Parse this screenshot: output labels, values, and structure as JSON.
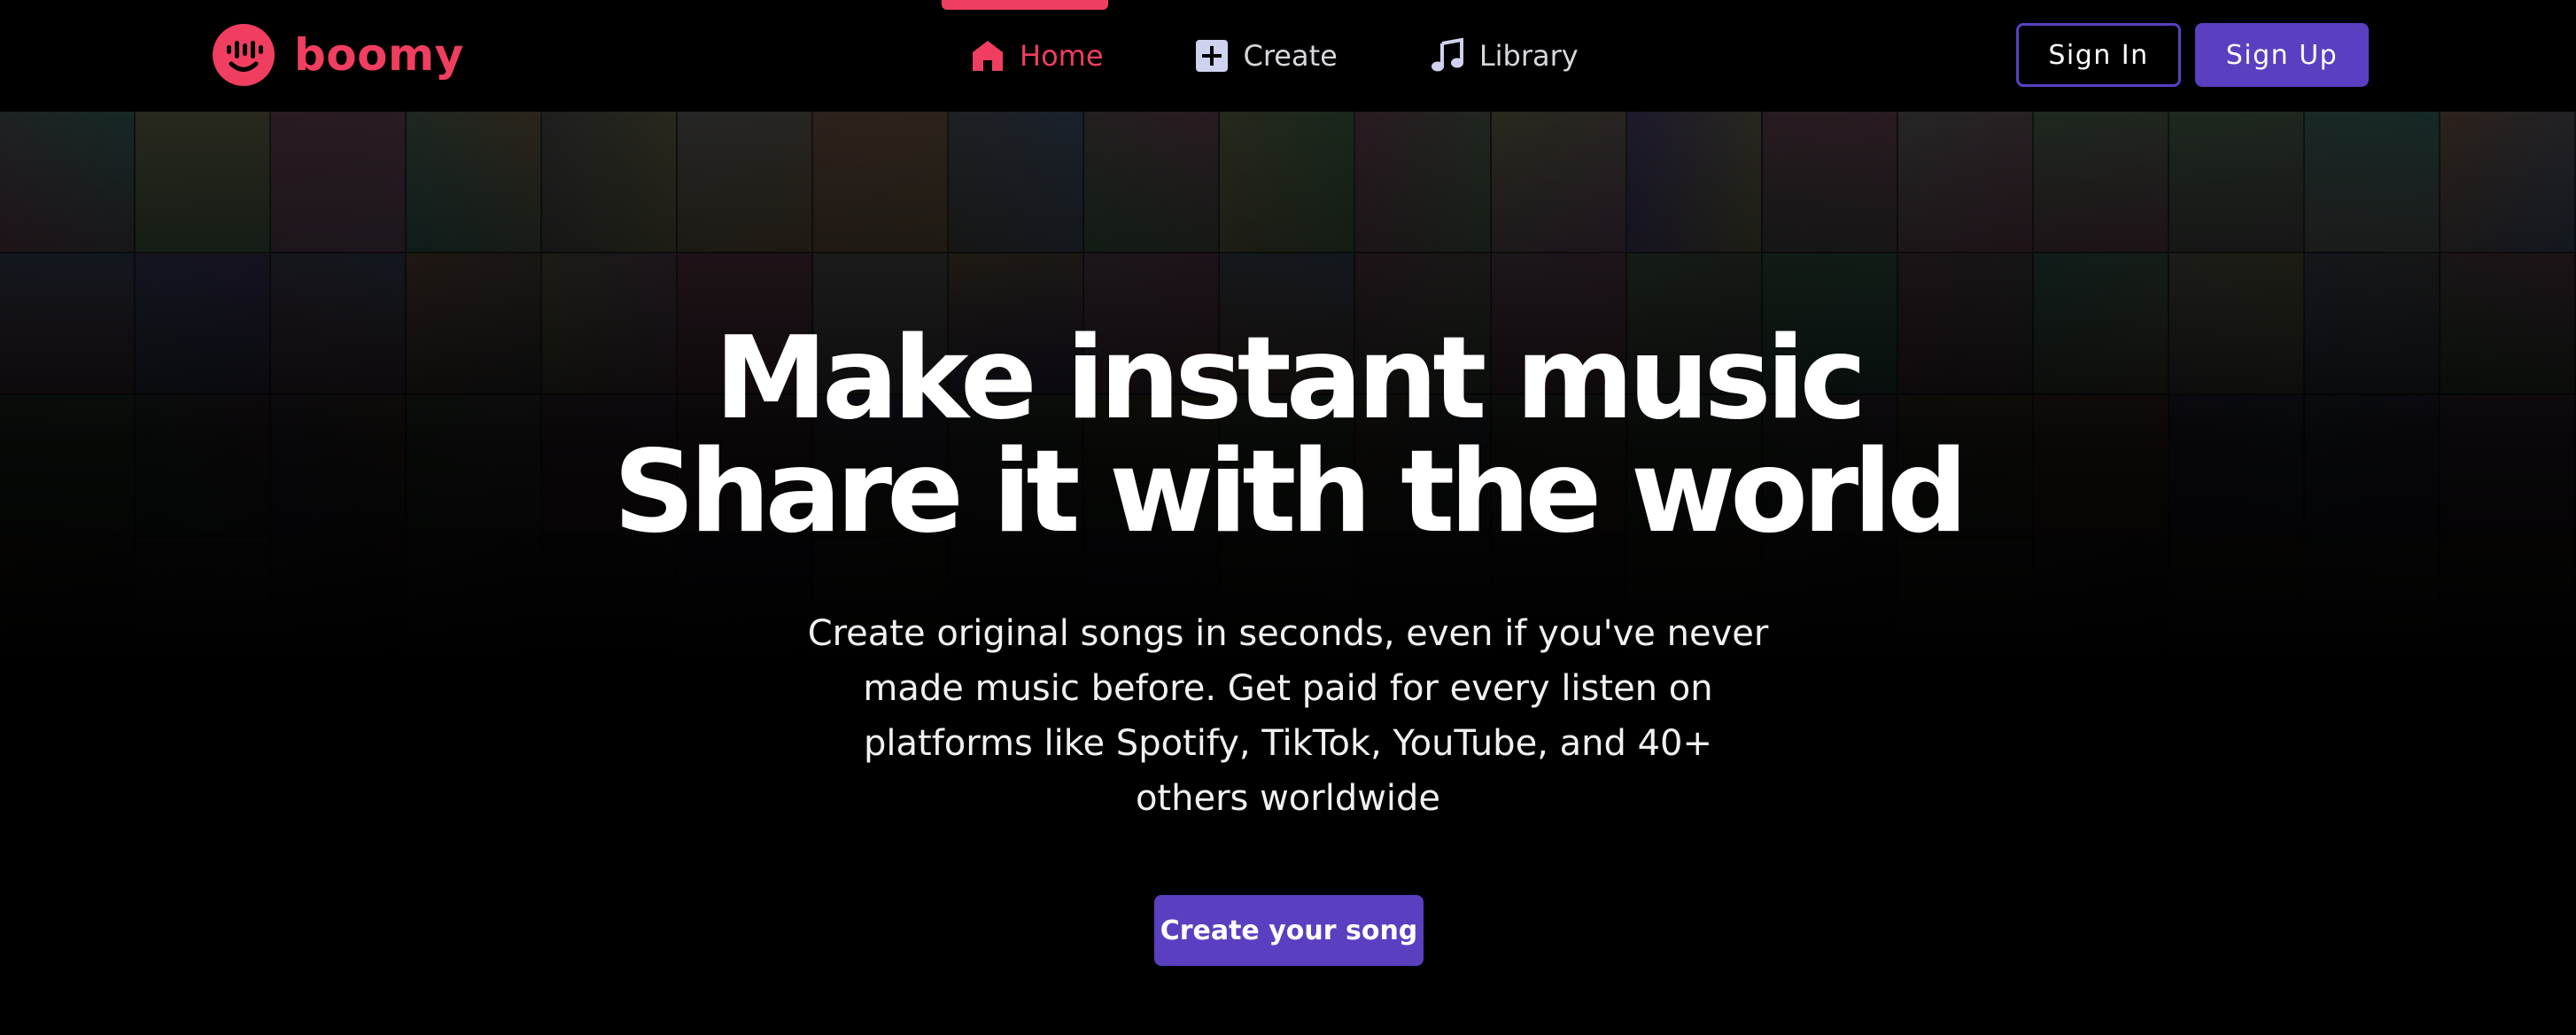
{
  "brand": {
    "name": "boomy",
    "accent_color": "#ef3e5f",
    "primary_color": "#5a3fc0",
    "logo_icon": "smiley-face-logo-icon"
  },
  "nav": {
    "tabs": [
      {
        "label": "Home",
        "icon": "home-icon",
        "active": true
      },
      {
        "label": "Create",
        "icon": "plus-square-icon",
        "active": false
      },
      {
        "label": "Library",
        "icon": "music-note-icon",
        "active": false
      }
    ]
  },
  "auth": {
    "sign_in_label": "Sign In",
    "sign_up_label": "Sign Up"
  },
  "hero": {
    "headline_line1": "Make instant music",
    "headline_line2": "Share it with the world",
    "subtext_lines": [
      "Create original songs in seconds, even if you've never",
      "made music before. Get paid for every listen on",
      "platforms like Spotify, TikTok, YouTube, and 40+",
      "others worldwide"
    ],
    "cta_label": "Create your song"
  }
}
